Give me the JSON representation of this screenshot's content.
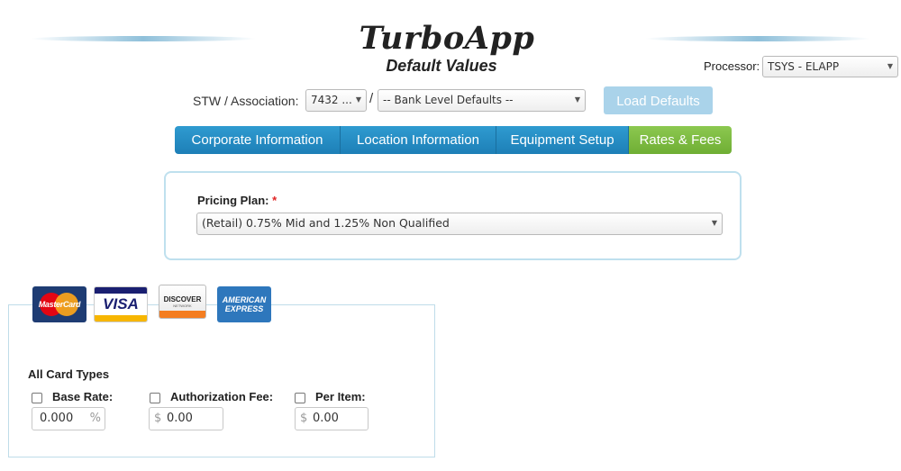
{
  "header": {
    "app_title": "TurboApp",
    "subtitle": "Default Values"
  },
  "processor": {
    "label": "Processor:",
    "value": "TSYS - ELAPP"
  },
  "stw": {
    "label": "STW / Association:",
    "stw_value": "7432 ...",
    "separator": "/",
    "association_value": "-- Bank Level Defaults --",
    "load_button": "Load Defaults"
  },
  "tabs": [
    {
      "label": "Corporate Information",
      "active": false
    },
    {
      "label": "Location Information",
      "active": false
    },
    {
      "label": "Equipment Setup",
      "active": false
    },
    {
      "label": "Rates & Fees",
      "active": true
    }
  ],
  "pricing": {
    "label": "Pricing Plan:",
    "required_mark": "*",
    "value": "(Retail) 0.75% Mid and 1.25% Non Qualified"
  },
  "cards": {
    "logos": {
      "mastercard": "MasterCard",
      "visa": "VISA",
      "discover": "DISCOVER",
      "discover_sub": "NETWORK",
      "amex_line1": "AMERICAN",
      "amex_line2": "EXPRESS"
    },
    "section_title": "All Card Types",
    "base_rate": {
      "label": "Base Rate:",
      "value": "0.000",
      "suffix": "%"
    },
    "authorization_fee": {
      "label": "Authorization Fee:",
      "prefix": "$",
      "value": "0.00"
    },
    "per_item": {
      "label": "Per Item:",
      "prefix": "$",
      "value": "0.00"
    }
  },
  "colors": {
    "tab_blue": "#1d7fb7",
    "tab_green": "#6fae34",
    "load_button": "#aad3ea",
    "required": "#e02424"
  }
}
